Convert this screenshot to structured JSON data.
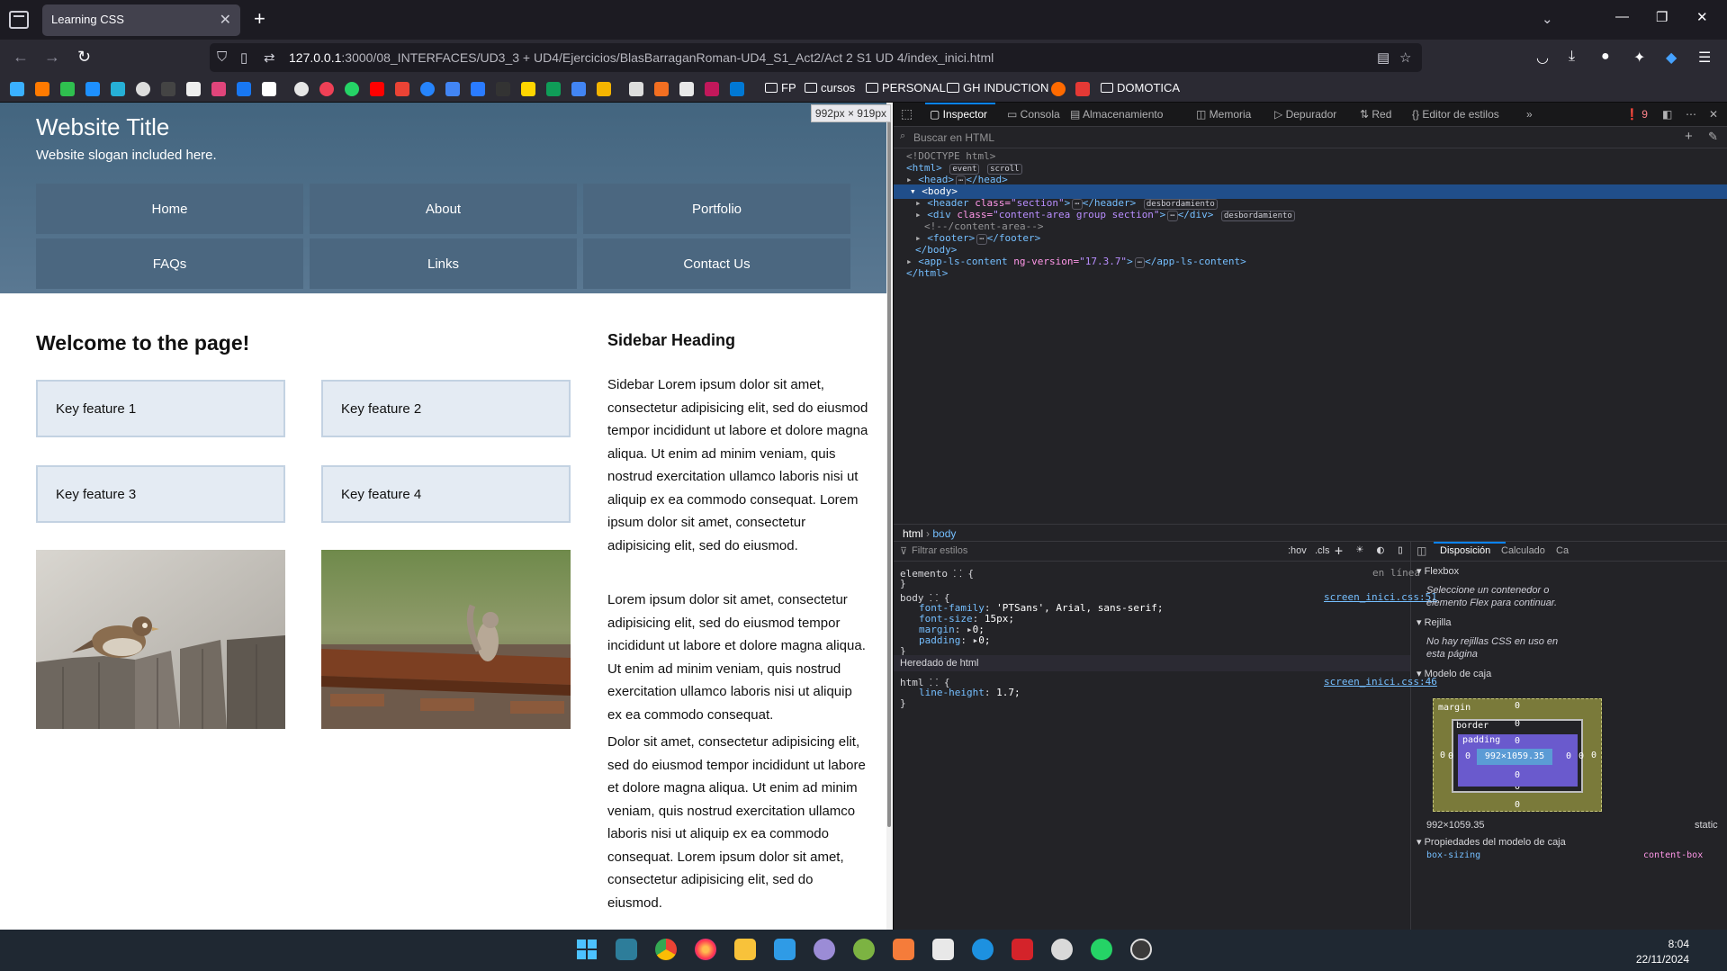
{
  "browser": {
    "tab_title": "Learning CSS",
    "url_host": "127.0.0.1",
    "url_path": ":3000/08_INTERFACES/UD3_3 + UD4/Ejercicios/BlasBarraganRoman-UD4_S1_Act2/Act 2 S1 UD 4/index_inici.html",
    "bookmark_folders": [
      "FP",
      "cursos",
      "PERSONAL",
      "GH INDUCTION",
      "DOMOTICA"
    ],
    "viewport_size": "992px × 919px"
  },
  "page": {
    "site_title": "Website Title",
    "site_slogan": "Website slogan included here.",
    "menu": [
      "Home",
      "About",
      "Portfolio",
      "FAQs",
      "Links",
      "Contact Us"
    ],
    "welcome_heading": "Welcome to the page!",
    "features": [
      "Key feature 1",
      "Key feature 2",
      "Key feature 3",
      "Key feature 4"
    ],
    "sidebar_heading": "Sidebar Heading",
    "sidebar_paragraphs": [
      "Sidebar Lorem ipsum dolor sit amet, consectetur adipisicing elit, sed do eiusmod tempor incididunt ut labore et dolore magna aliqua. Ut enim ad minim veniam, quis nostrud exercitation ullamco laboris nisi ut aliquip ex ea commodo consequat. Lorem ipsum dolor sit amet, consectetur adipisicing elit, sed do eiusmod.",
      "Lorem ipsum dolor sit amet, consectetur adipisicing elit, sed do eiusmod tempor incididunt ut labore et dolore magna aliqua. Ut enim ad minim veniam, quis nostrud exercitation ullamco laboris nisi ut aliquip ex ea commodo consequat.",
      "Dolor sit amet, consectetur adipisicing elit, sed do eiusmod tempor incididunt ut labore et dolore magna aliqua. Ut enim ad minim veniam, quis nostrud exercitation ullamco laboris nisi ut aliquip ex ea commodo consequat. Lorem ipsum dolor sit amet, consectetur adipisicing elit, sed do eiusmod."
    ]
  },
  "devtools": {
    "tabs": [
      "Inspector",
      "Consola",
      "Almacenamiento",
      "Memoria",
      "Depurador",
      "Red",
      "Editor de estilos"
    ],
    "error_count": "9",
    "search_placeholder": "Buscar en HTML",
    "breadcrumbs": [
      "html",
      "body"
    ],
    "filter_placeholder": "Filtrar estilos",
    "pseudo_toggles": [
      ":hov",
      ".cls"
    ],
    "element_rule": "elemento",
    "element_origin": "en línea",
    "body_selector": "body",
    "body_props": [
      {
        "name": "font-family",
        "value": "'PTSans', Arial, sans-serif;"
      },
      {
        "name": "font-size",
        "value": "15px;"
      },
      {
        "name": "margin",
        "value": "0;"
      },
      {
        "name": "padding",
        "value": "0;"
      }
    ],
    "body_source": "screen_inici.css:51",
    "inherited_label": "Heredado de html",
    "html_selector": "html",
    "html_prop": {
      "name": "line-height",
      "value": "1.7;"
    },
    "html_source": "screen_inici.css:46",
    "layout_tabs": [
      "Disposición",
      "Calculado",
      "Ca"
    ],
    "flexbox_label": "Flexbox",
    "flexbox_msg": "Seleccione un contenedor o elemento Flex para continuar.",
    "grid_label": "Rejilla",
    "grid_msg": "No hay rejillas CSS en uso en esta página",
    "boxmodel_label": "Modelo de caja",
    "box_content": "992×1059.35",
    "box_margin": "margin",
    "box_border": "border",
    "box_padding": "padding",
    "box_size": "992×1059.35",
    "box_position": "static",
    "props_label": "Propiedades del modelo de caja",
    "box_sizing_name": "box-sizing",
    "box_sizing_value": "content-box"
  },
  "taskbar": {
    "time": "8:04",
    "date": "22/11/2024"
  },
  "colors": {
    "header_bg": "#4f6e88",
    "menu_bg": "#4b6780",
    "feature_bg": "#e4ebf3",
    "devtools_bg": "#232327",
    "selection": "#204e8a"
  }
}
